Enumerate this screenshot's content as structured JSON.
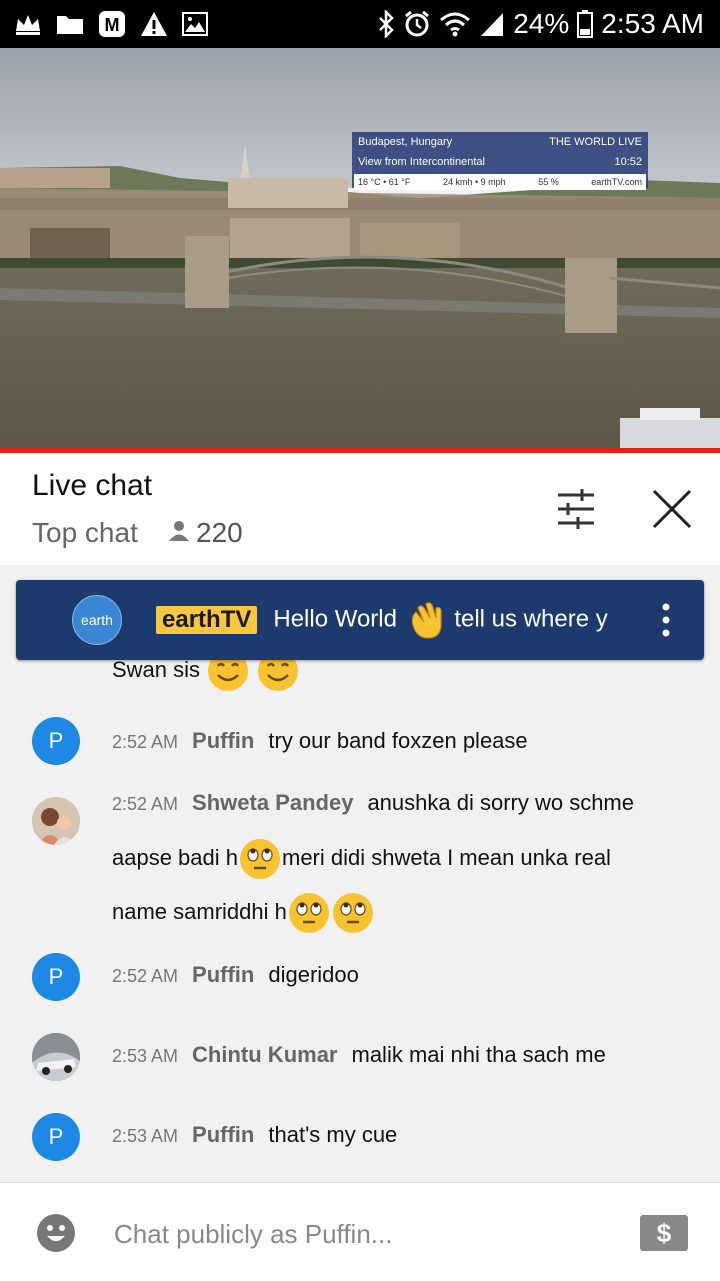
{
  "status_bar": {
    "battery": "24%",
    "time": "2:53 AM",
    "left_icons": [
      "crown-icon",
      "folder-icon",
      "m-app-icon",
      "warning-icon",
      "image-icon"
    ],
    "right_icons": [
      "bluetooth-icon",
      "alarm-icon",
      "wifi-icon",
      "signal-icon",
      "battery-icon"
    ]
  },
  "video": {
    "overlay": {
      "location": "Budapest, Hungary",
      "brand": "THE WORLD LIVE",
      "view": "View from Intercontinental",
      "local_time": "10:52",
      "weather": "16 °C • 61 °F",
      "wind": "24 kmh • 9 mph",
      "humidity": "55 %",
      "site": "earthTV.com"
    }
  },
  "header": {
    "title": "Live chat",
    "subtitle": "Top chat",
    "viewer_count": "220"
  },
  "pinned": {
    "avatar_text": "earth",
    "author": "earthTV",
    "message_start": "Hello World",
    "message_end": "tell us where y"
  },
  "partial_message": {
    "text": "Swan sis"
  },
  "messages": [
    {
      "time": "2:52 AM",
      "author": "Puffin",
      "text": "try our band foxzen please",
      "avatar_letter": "P"
    },
    {
      "time": "2:52 AM",
      "author": "Shweta Pandey",
      "text_1": "anushka di sorry wo schme",
      "text_2": "aapse badi h",
      "text_3": "meri didi shweta I mean unka real",
      "text_4": "name samriddhi h"
    },
    {
      "time": "2:52 AM",
      "author": "Puffin",
      "text": "digeridoo",
      "avatar_letter": "P"
    },
    {
      "time": "2:53 AM",
      "author": "Chintu Kumar",
      "text": "malik mai nhi tha sach me"
    },
    {
      "time": "2:53 AM",
      "author": "Puffin",
      "text": "that's my cue",
      "avatar_letter": "P"
    }
  ],
  "input": {
    "placeholder": "Chat publicly as Puffin...",
    "superchat_symbol": "$"
  },
  "colors": {
    "accent_red": "#e62117",
    "pinned_bg": "#1c3a6d",
    "author_badge": "#f9c640",
    "avatar_blue": "#1e88e5"
  }
}
